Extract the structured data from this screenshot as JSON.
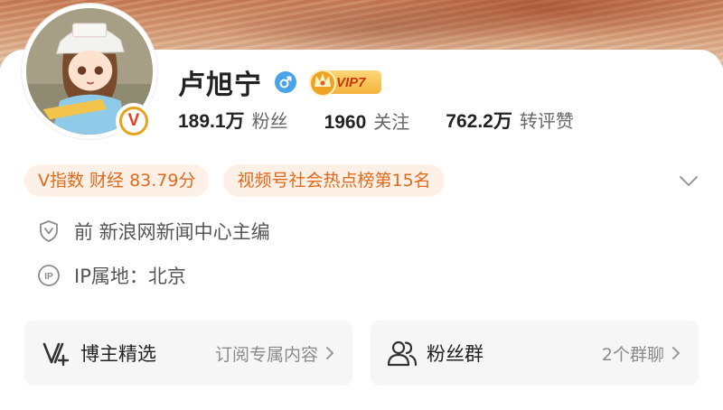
{
  "profile": {
    "name": "卢旭宁",
    "vip_label": "VIP7",
    "gender_icon": "male-icon",
    "verified_icon": "verified-v-icon"
  },
  "stats": [
    {
      "value": "189.1万",
      "label": "粉丝"
    },
    {
      "value": "1960",
      "label": "关注"
    },
    {
      "value": "762.2万",
      "label": "转评赞"
    }
  ],
  "tags": [
    {
      "text": "V指数 财经 83.79分"
    },
    {
      "text": "视频号社会热点榜第15名"
    }
  ],
  "info": {
    "title_text": "前 新浪网新闻中心主编",
    "ip_text": "IP属地：北京"
  },
  "cards": {
    "featured": {
      "title": "博主精选",
      "subtitle": "订阅专属内容"
    },
    "fans_group": {
      "title": "粉丝群",
      "subtitle": "2个群聊"
    }
  },
  "colors": {
    "accent_orange": "#e06a1c",
    "tag_bg": "#fdf0e6",
    "gender_blue": "#4aa3e8",
    "vip_gold": "#f3b23c"
  }
}
